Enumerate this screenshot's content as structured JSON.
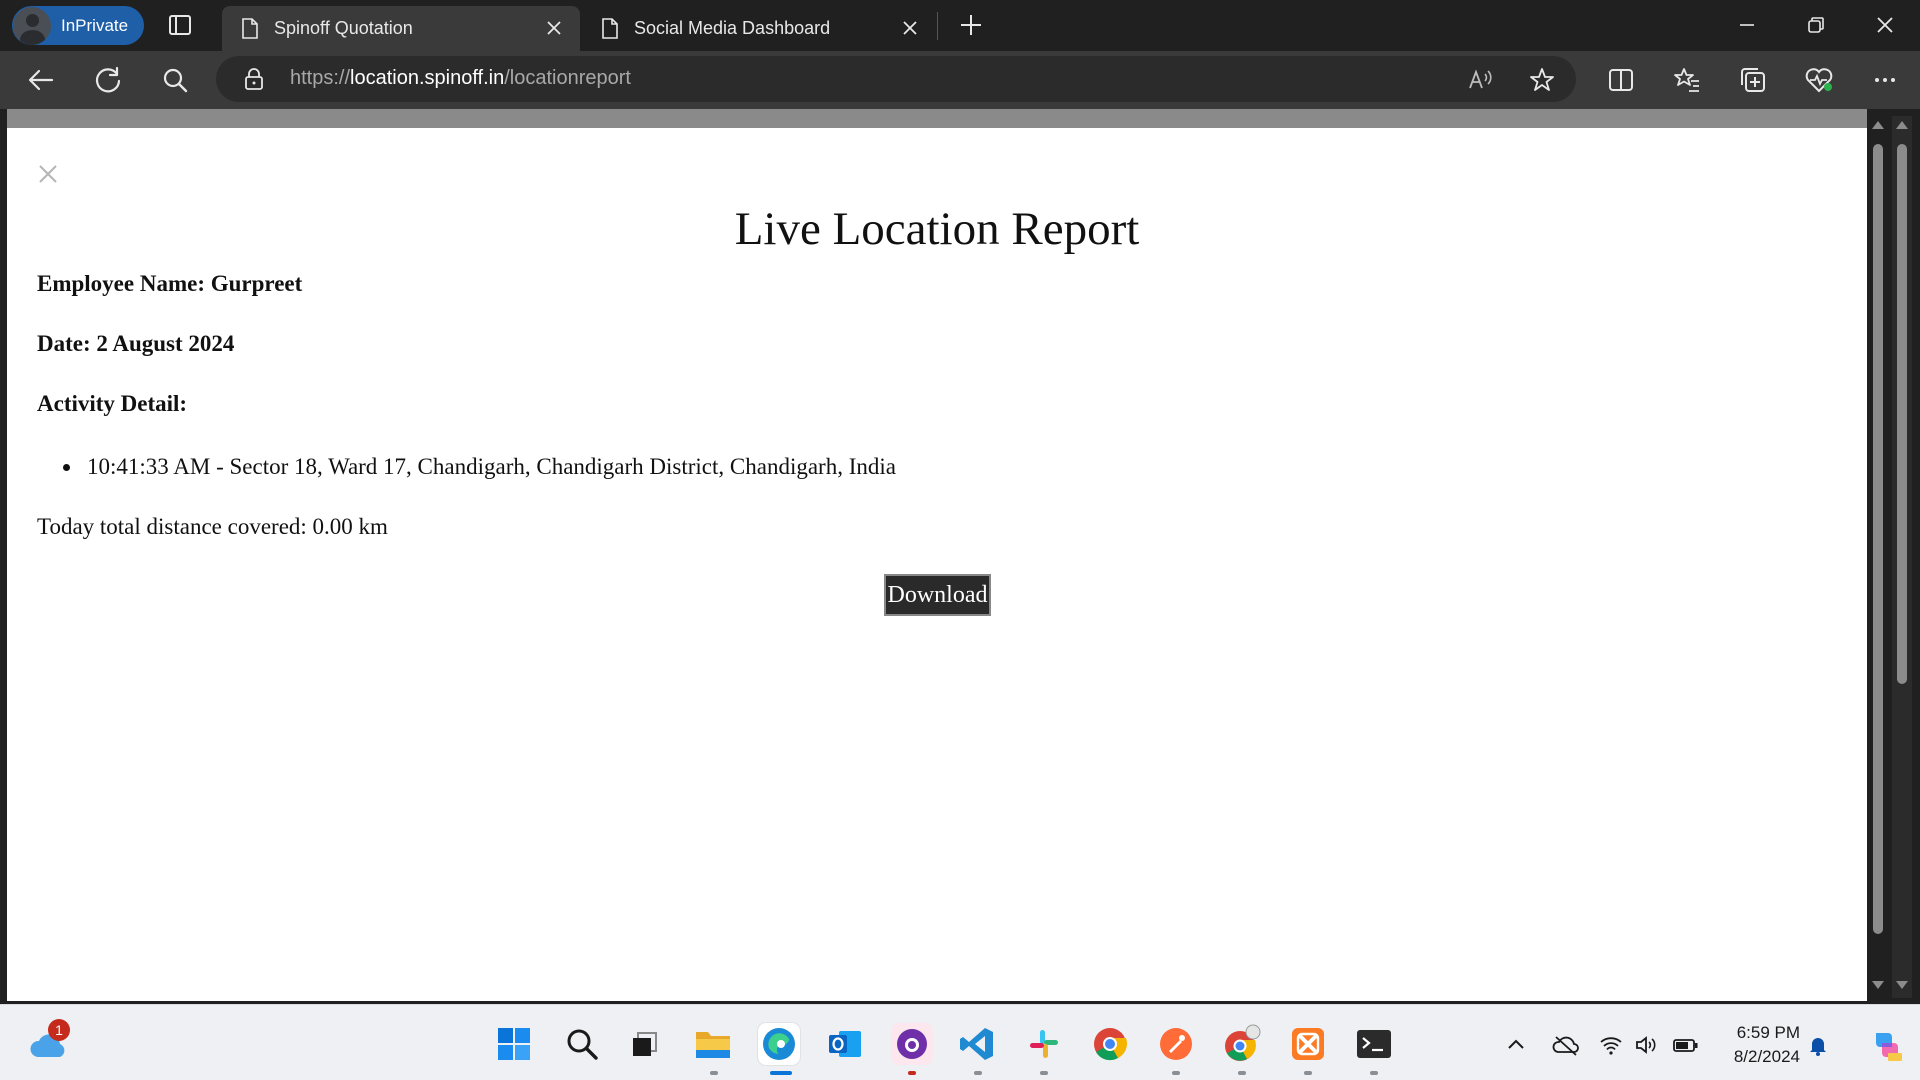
{
  "browser": {
    "inprivate_label": "InPrivate",
    "tabs": [
      {
        "title": "Spinoff Quotation",
        "active": true
      },
      {
        "title": "Social Media Dashboard",
        "active": false
      }
    ],
    "url_scheme": "https://",
    "url_host": "location.spinoff.in",
    "url_path": "/locationreport"
  },
  "page": {
    "title": "Live Location Report",
    "employee_name_label": "Employee Name: Gurpreet",
    "date_label": "Date: 2 August 2024",
    "activity_label": "Activity Detail:",
    "activities": [
      "10:41:33 AM - Sector 18, Ward 17, Chandigarh, Chandigarh District, Chandigarh, India"
    ],
    "distance_text": "Today total distance covered: 0.00 km",
    "download_label": "Download"
  },
  "taskbar": {
    "weather_badge": "1",
    "apps": [
      "start-icon",
      "search-icon",
      "task-view-icon",
      "file-explorer-icon",
      "edge-icon",
      "outlook-icon",
      "github-desktop-icon",
      "vscode-icon",
      "slack-icon",
      "chrome-icon",
      "postman-icon",
      "chrome-profile-icon",
      "xampp-icon",
      "terminal-icon"
    ],
    "time": "6:59 PM",
    "date": "8/2/2024"
  },
  "colors": {
    "accent": "#1f5fa8",
    "chrome_dark": "#202020",
    "toolbar": "#3a3a3a"
  }
}
